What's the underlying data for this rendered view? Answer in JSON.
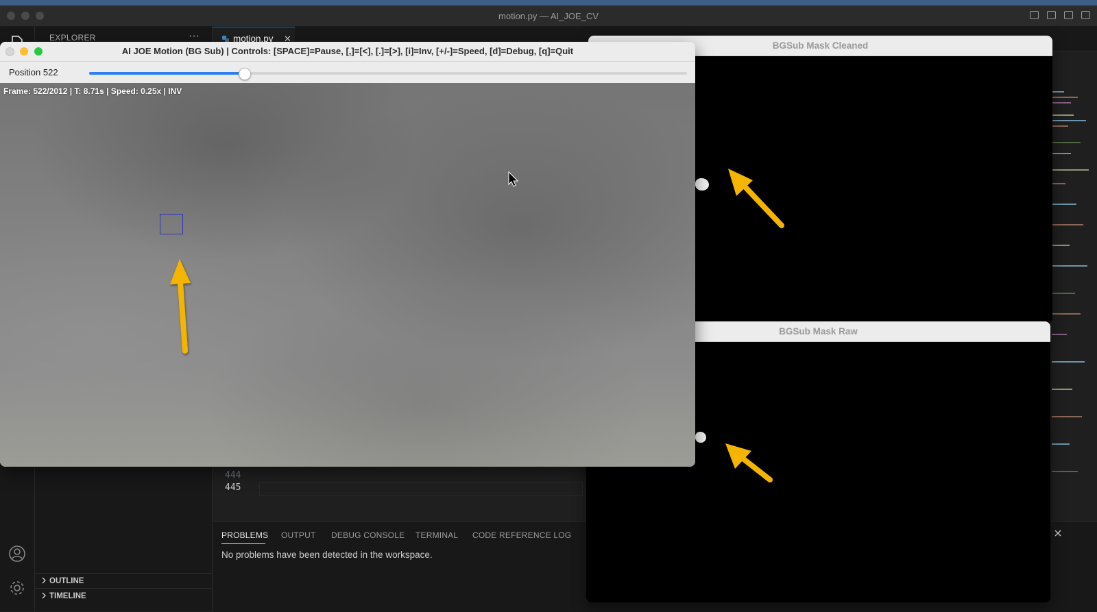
{
  "vscode": {
    "window_title": "motion.py — AI_JOE_CV",
    "sidebar": {
      "title": "EXPLORER",
      "more": "···",
      "sections": [
        "OUTLINE",
        "TIMELINE"
      ]
    },
    "editor": {
      "tab_name": "motion.py",
      "tab_close": "✕",
      "line_numbers": [
        "444",
        "445"
      ]
    },
    "panel": {
      "tabs": [
        "PROBLEMS",
        "OUTPUT",
        "DEBUG CONSOLE",
        "TERMINAL",
        "CODE REFERENCE LOG"
      ],
      "active_tab": "PROBLEMS",
      "message": "No problems have been detected in the workspace."
    }
  },
  "cv_main": {
    "title": "AI JOE Motion (BG Sub) | Controls: [SPACE]=Pause, [,]=[<], [.]=[>], [i]=Inv, [+/-]=Speed, [d]=Debug, [q]=Quit",
    "position_label": "Position 522",
    "position": 522,
    "frame_count": 2012,
    "slider_fraction": 0.259,
    "frame_info": "Frame: 522/2012 | T: 8.71s | Speed: 0.25x | INV"
  },
  "mask_cleaned": {
    "title": "BGSub Mask Cleaned"
  },
  "mask_raw": {
    "title": "BGSub Mask Raw"
  },
  "colors": {
    "annotation_arrow": "#f5b400",
    "slider_fill": "#2f7ef2",
    "detection_box": "#2f33b8",
    "close": "#ff5f57",
    "minimize": "#febc2e",
    "zoom": "#28c840"
  }
}
